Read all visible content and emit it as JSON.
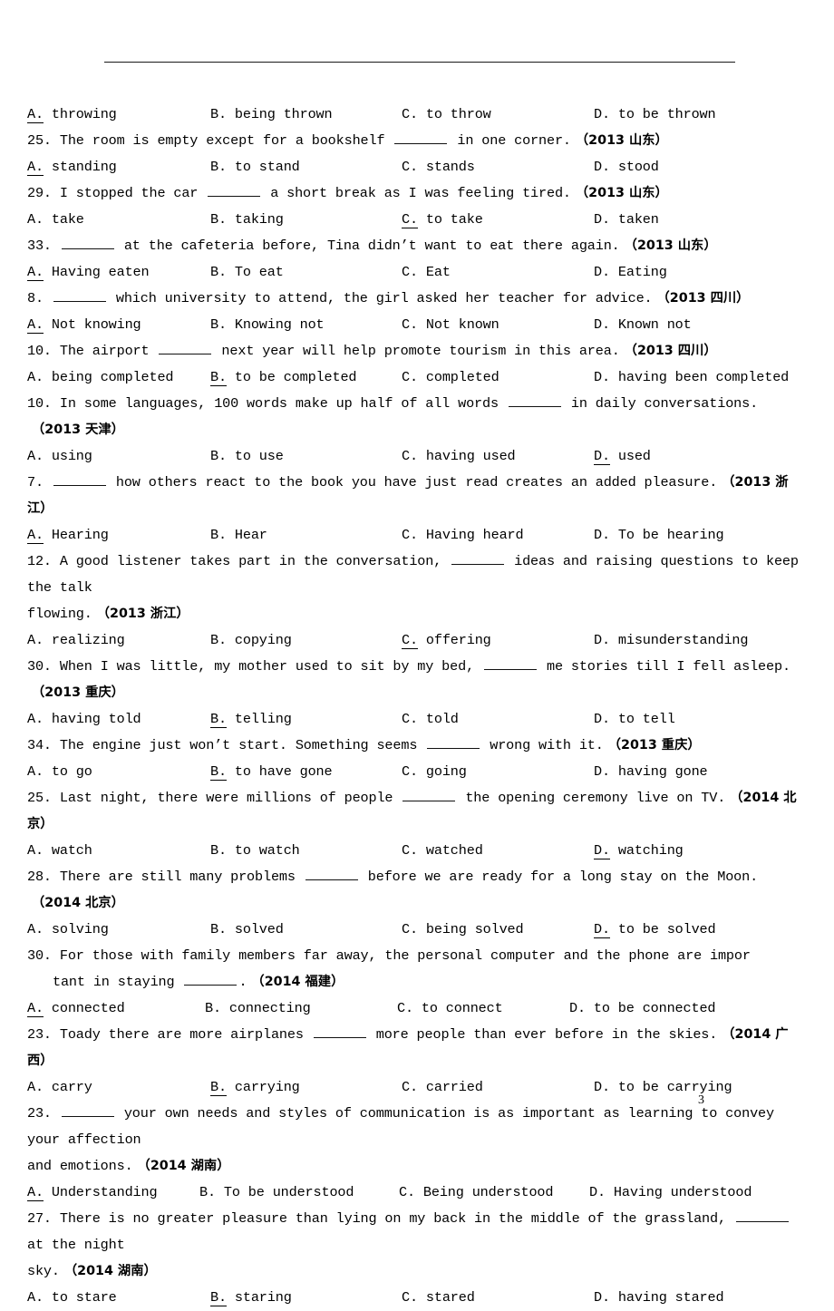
{
  "document": {
    "page_number": "3",
    "header_rule": true
  },
  "items": [
    {
      "kind": "options",
      "name": "options-row-q24",
      "layout": "wide",
      "options": [
        {
          "letter": "A.",
          "text": "throwing",
          "correct": true
        },
        {
          "letter": "B.",
          "text": "being thrown",
          "correct": false
        },
        {
          "letter": "C.",
          "text": "to throw",
          "correct": false
        },
        {
          "letter": "D.",
          "text": "to be thrown",
          "correct": false
        }
      ]
    },
    {
      "kind": "question",
      "name": "question-25",
      "number": "25.",
      "before": "The room is empty except for a bookshelf",
      "blank": "w2",
      "after": "in one corner.",
      "tag": "（2013 山东）"
    },
    {
      "kind": "options",
      "name": "options-row-q25",
      "layout": "wide",
      "options": [
        {
          "letter": "A.",
          "text": "standing",
          "correct": true
        },
        {
          "letter": "B.",
          "text": "to stand",
          "correct": false
        },
        {
          "letter": "C.",
          "text": "stands",
          "correct": false
        },
        {
          "letter": "D.",
          "text": "stood",
          "correct": false
        }
      ]
    },
    {
      "kind": "question",
      "name": "question-29",
      "number": "29.",
      "before": "I stopped the car",
      "blank": "w2",
      "after": "a short break as I was feeling tired.",
      "tag": "（2013 山东）"
    },
    {
      "kind": "options",
      "name": "options-row-q29",
      "layout": "wide",
      "options": [
        {
          "letter": "A.",
          "text": "take",
          "correct": false
        },
        {
          "letter": "B.",
          "text": "taking",
          "correct": false
        },
        {
          "letter": "C.",
          "text": "to take",
          "correct": true
        },
        {
          "letter": "D.",
          "text": "taken",
          "correct": false
        }
      ]
    },
    {
      "kind": "question",
      "name": "question-33",
      "number": "33.",
      "before": "",
      "blank": "w2",
      "after": "at the cafeteria before, Tina didn’t want to eat there again.",
      "tag": "（2013 山东）"
    },
    {
      "kind": "options",
      "name": "options-row-q33",
      "layout": "wide",
      "options": [
        {
          "letter": "A.",
          "text": "Having eaten",
          "correct": true
        },
        {
          "letter": "B.",
          "text": "To eat",
          "correct": false
        },
        {
          "letter": "C.",
          "text": "Eat",
          "correct": false
        },
        {
          "letter": "D.",
          "text": "Eating",
          "correct": false
        }
      ]
    },
    {
      "kind": "question",
      "name": "question-8",
      "number": "8.",
      "before": "",
      "blank": "w2",
      "after": "which university to attend, the girl asked her teacher for advice.",
      "tag": "（2013 四川）"
    },
    {
      "kind": "options",
      "name": "options-row-q8",
      "layout": "wide",
      "options": [
        {
          "letter": "A.",
          "text": "Not knowing",
          "correct": true
        },
        {
          "letter": "B.",
          "text": "Knowing not",
          "correct": false
        },
        {
          "letter": "C.",
          "text": "Not known",
          "correct": false
        },
        {
          "letter": "D.",
          "text": "Known not",
          "correct": false
        }
      ]
    },
    {
      "kind": "question",
      "name": "question-10-sichuan",
      "number": "10.",
      "before": "The airport",
      "blank": "w2",
      "after": "next year will help promote tourism in this area.",
      "tag": "（2013 四川）"
    },
    {
      "kind": "options",
      "name": "options-row-q10-sichuan",
      "layout": "wide",
      "options": [
        {
          "letter": "A.",
          "text": "being completed",
          "correct": false
        },
        {
          "letter": "B.",
          "text": "to be completed",
          "correct": true
        },
        {
          "letter": "C.",
          "text": "completed",
          "correct": false
        },
        {
          "letter": "D.",
          "text": "having been completed",
          "correct": false
        }
      ]
    },
    {
      "kind": "question",
      "name": "question-10-tianjin",
      "number": "10.",
      "before": "In some languages, 100 words make up half of all words",
      "blank": "w2",
      "after": "in daily conversations.",
      "tag": "（2013 天津）"
    },
    {
      "kind": "options",
      "name": "options-row-q10-tianjin",
      "layout": "wide",
      "options": [
        {
          "letter": "A.",
          "text": "using",
          "correct": false
        },
        {
          "letter": "B.",
          "text": "to use",
          "correct": false
        },
        {
          "letter": "C.",
          "text": "having used",
          "correct": false
        },
        {
          "letter": "D.",
          "text": "used",
          "correct": true
        }
      ]
    },
    {
      "kind": "question",
      "name": "question-7",
      "number": "7.",
      "before": "",
      "blank": "w2",
      "after": "how others react to the book you have just read creates an added pleasure.",
      "tag": "（2013 浙江）"
    },
    {
      "kind": "options",
      "name": "options-row-q7",
      "layout": "wide",
      "options": [
        {
          "letter": "A.",
          "text": "Hearing",
          "correct": true
        },
        {
          "letter": "B.",
          "text": "Hear",
          "correct": false
        },
        {
          "letter": "C.",
          "text": "Having heard",
          "correct": false
        },
        {
          "letter": "D.",
          "text": "To be hearing",
          "correct": false
        }
      ]
    },
    {
      "kind": "question-wrap",
      "name": "question-12",
      "number": "12.",
      "before": "A good listener takes part in the conversation,",
      "blank": "w2",
      "after": "ideas and raising questions to keep the talk",
      "cont": "flowing.",
      "cont_indent": false,
      "tag": "（2013 浙江）",
      "justify": false
    },
    {
      "kind": "options",
      "name": "options-row-q12",
      "layout": "wide",
      "options": [
        {
          "letter": "A.",
          "text": "realizing",
          "correct": false
        },
        {
          "letter": "B.",
          "text": "copying",
          "correct": false
        },
        {
          "letter": "C.",
          "text": "offering",
          "correct": true
        },
        {
          "letter": "D.",
          "text": "misunderstanding",
          "correct": false
        }
      ]
    },
    {
      "kind": "question",
      "name": "question-30-chongqing",
      "number": "30.",
      "before": "When I was little, my mother used to sit by my bed,",
      "blank": "w2",
      "after": "me stories till I fell asleep.",
      "tag": "（2013 重庆）"
    },
    {
      "kind": "options",
      "name": "options-row-q30-chongqing",
      "layout": "wide",
      "options": [
        {
          "letter": "A.",
          "text": "having told",
          "correct": false
        },
        {
          "letter": "B.",
          "text": "telling",
          "correct": true
        },
        {
          "letter": "C.",
          "text": "told",
          "correct": false
        },
        {
          "letter": "D.",
          "text": "to tell",
          "correct": false
        }
      ]
    },
    {
      "kind": "question",
      "name": "question-34",
      "number": "34.",
      "before": "The engine just won’t start. Something seems",
      "blank": "w2",
      "after": "wrong with it.",
      "tag": "（2013 重庆）"
    },
    {
      "kind": "options",
      "name": "options-row-q34",
      "layout": "wide",
      "options": [
        {
          "letter": "A.",
          "text": "to go",
          "correct": false
        },
        {
          "letter": "B.",
          "text": "to have gone",
          "correct": true
        },
        {
          "letter": "C.",
          "text": "going",
          "correct": false
        },
        {
          "letter": "D.",
          "text": "having gone",
          "correct": false
        }
      ]
    },
    {
      "kind": "question",
      "name": "question-25-beijing",
      "number": "25.",
      "before": "Last night, there were millions of people",
      "blank": "w2",
      "after": "the opening ceremony live on TV.",
      "tag": "（2014 北京）"
    },
    {
      "kind": "options",
      "name": "options-row-q25-beijing",
      "layout": "wide",
      "options": [
        {
          "letter": "A.",
          "text": "watch",
          "correct": false
        },
        {
          "letter": "B.",
          "text": "to watch",
          "correct": false
        },
        {
          "letter": "C.",
          "text": "watched",
          "correct": false
        },
        {
          "letter": "D.",
          "text": "watching",
          "correct": true
        }
      ]
    },
    {
      "kind": "question",
      "name": "question-28",
      "number": "28.",
      "before": "There are still many problems",
      "blank": "w2",
      "after": "before we are ready for a long stay on the Moon.",
      "tag": "（2014 北京）"
    },
    {
      "kind": "options",
      "name": "options-row-q28",
      "layout": "wide",
      "options": [
        {
          "letter": "A.",
          "text": "solving",
          "correct": false
        },
        {
          "letter": "B.",
          "text": "solved",
          "correct": false
        },
        {
          "letter": "C.",
          "text": "being solved",
          "correct": false
        },
        {
          "letter": "D.",
          "text": "to be solved",
          "correct": true
        }
      ]
    },
    {
      "kind": "question-wrap",
      "name": "question-30-fujian",
      "number": "30.",
      "before": "For those with family members far away, the personal computer and the phone are impor",
      "blank": null,
      "after": "",
      "cont": "tant in staying",
      "cont_blank": "w2",
      "cont_after": ".",
      "cont_indent": true,
      "tag": "（2014 福建）",
      "justify": true
    },
    {
      "kind": "options",
      "name": "options-row-q30-fujian",
      "layout": "spread",
      "options": [
        {
          "letter": "A.",
          "text": "connected",
          "correct": true
        },
        {
          "letter": "B.",
          "text": "connecting",
          "correct": false
        },
        {
          "letter": "C.",
          "text": "to connect",
          "correct": false
        },
        {
          "letter": "D.",
          "text": "to be connected",
          "correct": false
        }
      ]
    },
    {
      "kind": "question",
      "name": "question-23-guangxi",
      "number": "23.",
      "before": "Toady there are more airplanes",
      "blank": "w2",
      "after": "more people than ever before in the skies.",
      "tag": "（2014 广西）"
    },
    {
      "kind": "options",
      "name": "options-row-q23-guangxi",
      "layout": "wide",
      "options": [
        {
          "letter": "A.",
          "text": "carry",
          "correct": false
        },
        {
          "letter": "B.",
          "text": "carrying",
          "correct": true
        },
        {
          "letter": "C.",
          "text": "carried",
          "correct": false
        },
        {
          "letter": "D.",
          "text": "to be carrying",
          "correct": false
        }
      ]
    },
    {
      "kind": "question-wrap",
      "name": "question-23-hunan",
      "number": "23.",
      "before": "",
      "blank": "w2",
      "after": "your own needs and styles of communication is as important as learning to convey your affection",
      "cont": "and emotions.",
      "cont_indent": false,
      "tag": "（2014 湖南）",
      "justify": false
    },
    {
      "kind": "options",
      "name": "options-row-q23-hunan",
      "layout": "narrow",
      "options": [
        {
          "letter": "A.",
          "text": "Understanding",
          "correct": true
        },
        {
          "letter": "B.",
          "text": "To be understood",
          "correct": false
        },
        {
          "letter": "C.",
          "text": "Being understood",
          "correct": false
        },
        {
          "letter": "D.",
          "text": "Having understood",
          "correct": false
        }
      ]
    },
    {
      "kind": "question-wrap",
      "name": "question-27",
      "number": "27.",
      "before": "There is no greater pleasure than lying on my back in the middle of the grassland,",
      "blank": "w2",
      "after": "at the night",
      "cont": "sky.",
      "cont_indent": false,
      "tag": "（2014 湖南）",
      "justify": false
    },
    {
      "kind": "options",
      "name": "options-row-q27",
      "layout": "wide",
      "options": [
        {
          "letter": "A.",
          "text": "to stare",
          "correct": false
        },
        {
          "letter": "B.",
          "text": "staring",
          "correct": true
        },
        {
          "letter": "C.",
          "text": "stared",
          "correct": false
        },
        {
          "letter": "D.",
          "text": "having stared",
          "correct": false
        }
      ]
    }
  ]
}
